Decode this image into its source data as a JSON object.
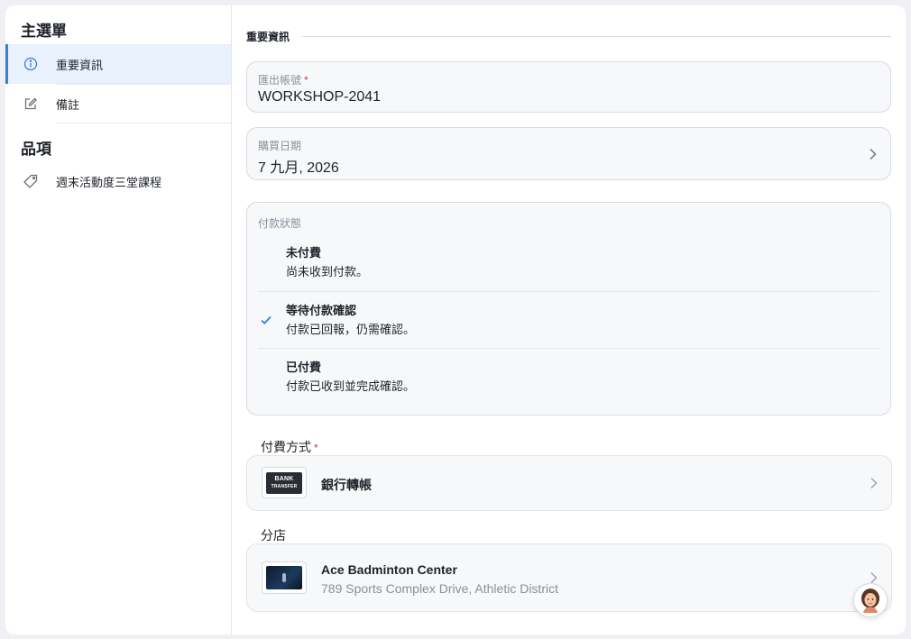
{
  "sidebar": {
    "section_main": "主選單",
    "items": [
      {
        "label": "重要資訊",
        "icon": "info-icon",
        "active": true
      },
      {
        "label": "備註",
        "icon": "edit-icon",
        "active": false
      }
    ],
    "section_items": "品項",
    "product_items": [
      {
        "label": "週末活動度三堂課程",
        "icon": "tag-icon"
      }
    ]
  },
  "main": {
    "section_title": "重要資訊",
    "account": {
      "label": "匯出帳號",
      "required_mark": "*",
      "value": "WORKSHOP-2041"
    },
    "purchase_date": {
      "label": "購買日期",
      "value": "7 九月, 2026"
    },
    "payment_status": {
      "label": "付款狀態",
      "options": [
        {
          "title": "未付費",
          "desc": "尚未收到付款。",
          "selected": false
        },
        {
          "title": "等待付款確認",
          "desc": "付款已回報，仍需確認。",
          "selected": true
        },
        {
          "title": "已付費",
          "desc": "付款已收到並完成確認。",
          "selected": false
        }
      ]
    },
    "payment_method": {
      "label": "付費方式",
      "required_mark": "*",
      "value": "銀行轉帳",
      "logo_text_1": "BANK",
      "logo_text_2": "TRANSFER"
    },
    "branch": {
      "label": "分店",
      "name": "Ace Badminton Center",
      "address": "789 Sports Complex Drive, Athletic District"
    }
  },
  "colors": {
    "accent": "#3b7ddd",
    "required": "#d9363e",
    "active_bg": "#e8f1fc"
  }
}
